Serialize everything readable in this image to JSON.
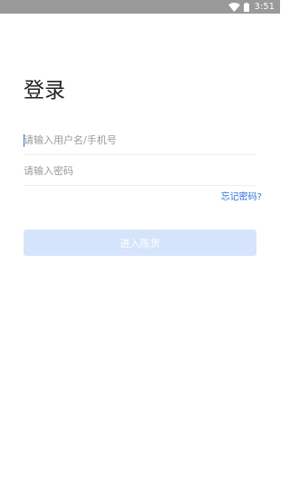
{
  "status_bar": {
    "time": "3:51"
  },
  "page": {
    "title": "登录"
  },
  "form": {
    "username_placeholder": "请输入用户名/手机号",
    "username_value": "",
    "password_placeholder": "请输入密码",
    "password_value": "",
    "forgot_password": "忘记密码?",
    "submit_label": "进入陈货"
  },
  "colors": {
    "status_bar": "#999999",
    "link": "#2f6fd6",
    "button_disabled": "#d6e4fb"
  }
}
